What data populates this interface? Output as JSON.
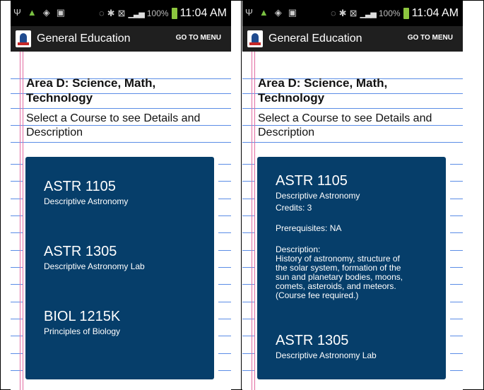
{
  "status": {
    "battery_percent": "100%",
    "time": "11:04 AM"
  },
  "app": {
    "title": "General Education",
    "menu_label": "GO TO MENU"
  },
  "page": {
    "heading_line1": "Area D: Science, Math,",
    "heading_line2": "Technology",
    "subheading_line1": "Select a Course to see Details and",
    "subheading_line2": "Description"
  },
  "left_courses": [
    {
      "code": "ASTR 1105",
      "name": "Descriptive Astronomy"
    },
    {
      "code": "ASTR 1305",
      "name": "Descriptive Astronomy Lab"
    },
    {
      "code": "BIOL 1215K",
      "name": "Principles of Biology"
    }
  ],
  "right_courses": {
    "expanded": {
      "code": "ASTR 1105",
      "name": "Descriptive Astronomy",
      "credits": "Credits: 3",
      "prerequisites": "Prerequisites: NA",
      "description_label": "Description:",
      "description_lines": [
        "History of astronomy, structure of",
        "the solar system, formation of the",
        "sun and planetary bodies, moons,",
        "comets, asteroids, and meteors.",
        "(Course fee required.)"
      ]
    },
    "next": {
      "code": "ASTR 1305",
      "name": "Descriptive Astronomy Lab"
    }
  },
  "icons": [
    "usb-icon",
    "android-icon",
    "wifi-icon",
    "image-icon",
    "nfc-icon",
    "bluetooth-icon",
    "mute-icon",
    "signal-icon",
    "battery-icon"
  ],
  "colors": {
    "card": "#063e6a",
    "appbar": "#1f1f1f",
    "rule_blue": "#5b8de6",
    "margin_pink": "#e26ba1"
  }
}
